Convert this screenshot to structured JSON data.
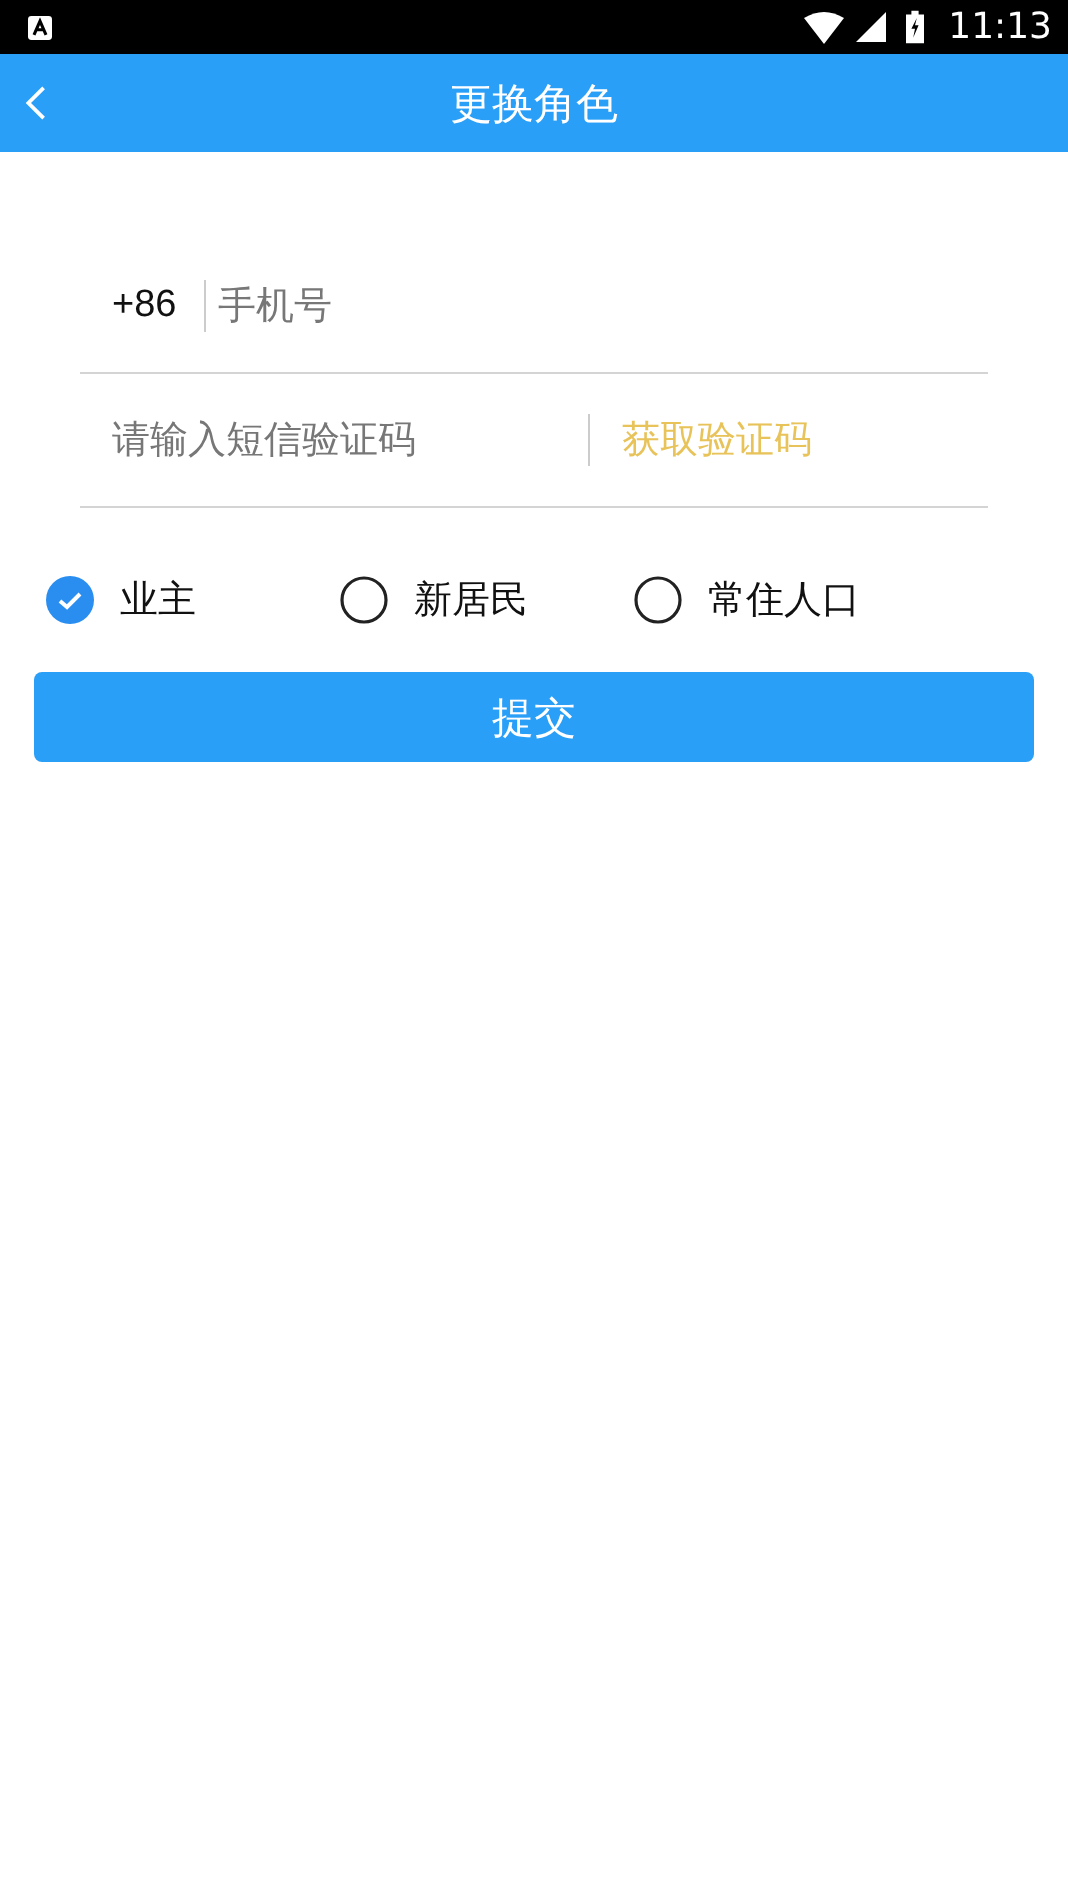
{
  "status_bar": {
    "time": "11:13"
  },
  "app_bar": {
    "title": "更换角色"
  },
  "phone_field": {
    "prefix": "+86",
    "placeholder": "手机号"
  },
  "code_field": {
    "placeholder": "请输入短信验证码",
    "action": "获取验证码"
  },
  "roles": [
    {
      "label": "业主",
      "selected": true
    },
    {
      "label": "新居民",
      "selected": false
    },
    {
      "label": "常住人口",
      "selected": false
    }
  ],
  "submit": "提交"
}
